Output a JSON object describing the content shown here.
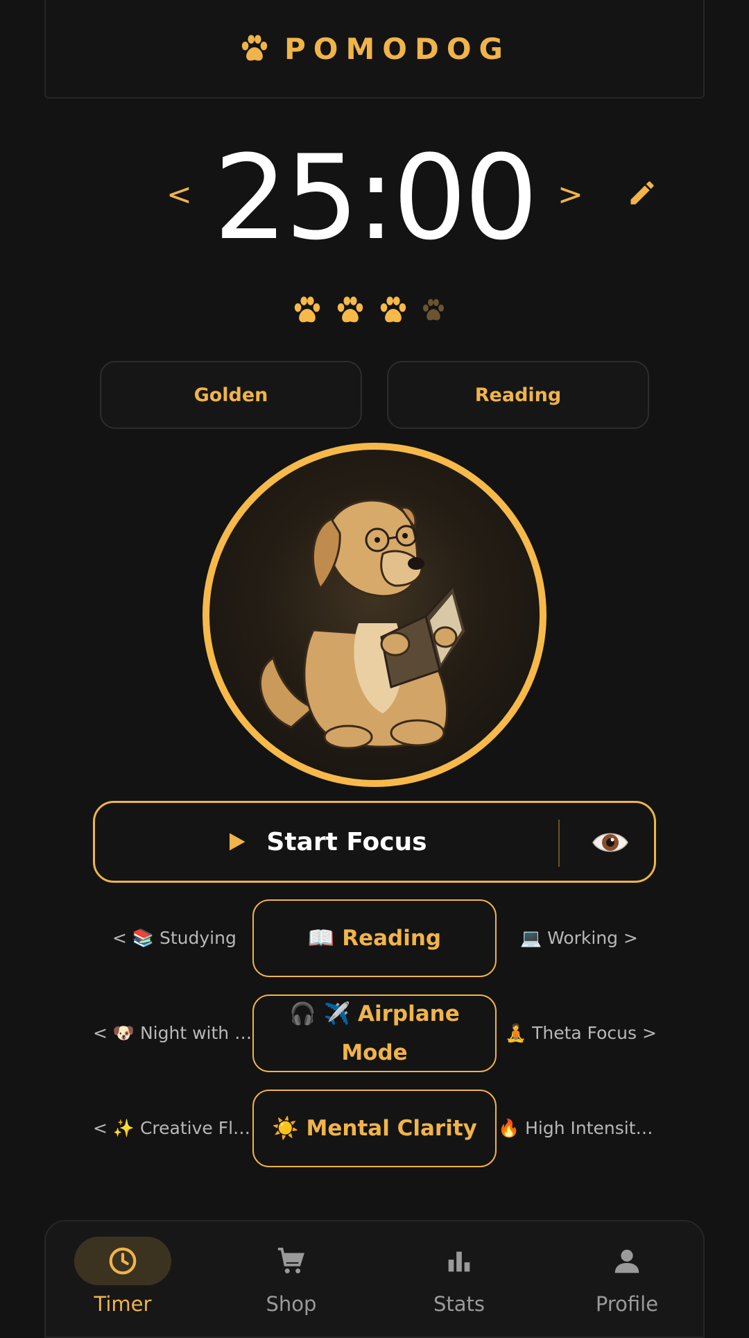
{
  "header": {
    "title": "POMODOG",
    "logo_icon": "paw-icon"
  },
  "timer": {
    "prev_label": "<",
    "time": "25:00",
    "next_label": ">",
    "edit_icon": "pencil-icon"
  },
  "sessions": {
    "completed": 3,
    "total": 4
  },
  "selectors": {
    "breed": "Golden",
    "activity": "Reading"
  },
  "start": {
    "label": "Start Focus",
    "play_icon": "play-icon",
    "preview_icon": "eye-icon"
  },
  "modes": [
    {
      "prev": "< 📚 Studying",
      "current": "📖 Reading",
      "next": "💻 Working >"
    },
    {
      "prev": "< 🐶 Night with …",
      "current": "🎧 ✈️ Airplane Mode",
      "next": "🧘 Theta Focus >"
    },
    {
      "prev": "< ✨ Creative Fl…",
      "current": "☀️ Mental Clarity",
      "next": "🔥 High Intensit…"
    }
  ],
  "nav": [
    {
      "label": "Timer",
      "icon": "clock-icon",
      "active": true
    },
    {
      "label": "Shop",
      "icon": "cart-icon",
      "active": false
    },
    {
      "label": "Stats",
      "icon": "bar-chart-icon",
      "active": false
    },
    {
      "label": "Profile",
      "icon": "person-icon",
      "active": false
    }
  ],
  "colors": {
    "accent": "#f0b44a",
    "background": "#131313",
    "muted": "#9a9a9a"
  }
}
